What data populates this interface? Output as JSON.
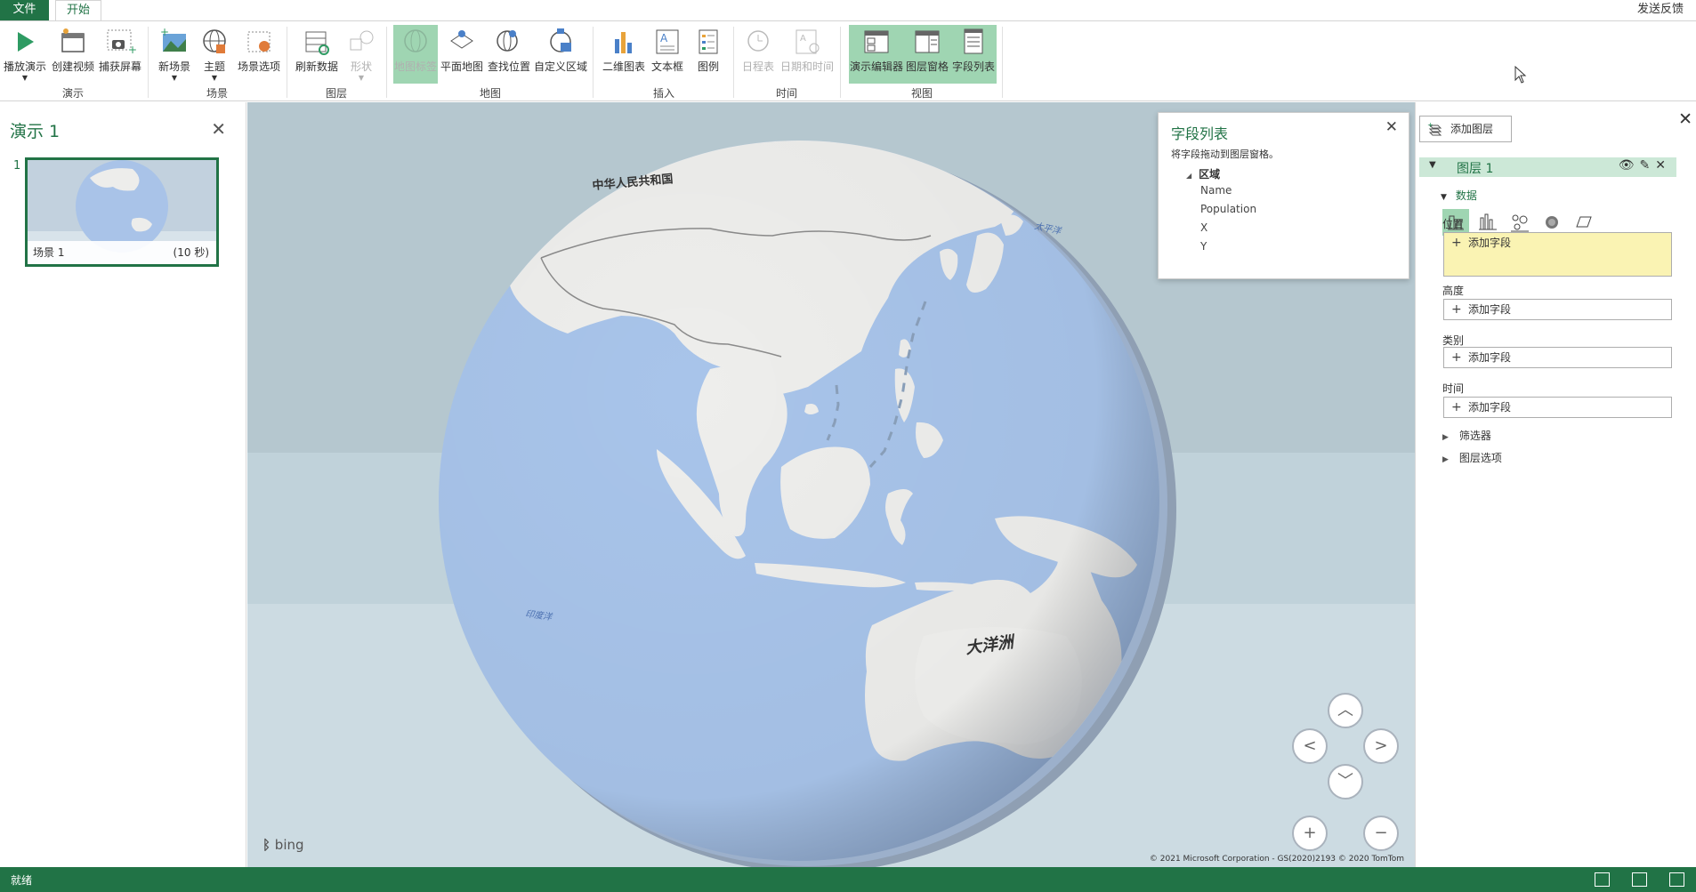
{
  "tabs": {
    "file": "文件",
    "home": "开始",
    "feedback": "发送反馈"
  },
  "ribbon": {
    "groups": [
      {
        "name": "演示",
        "buttons": [
          "播放演示",
          "创建视频",
          "捕获屏幕"
        ]
      },
      {
        "name": "场景",
        "buttons": [
          "新场景",
          "主题",
          "场景选项"
        ]
      },
      {
        "name": "图层",
        "buttons": [
          "刷新数据",
          "形状"
        ]
      },
      {
        "name": "地图",
        "buttons": [
          "地图标签",
          "平面地图",
          "查找位置",
          "自定义区域"
        ]
      },
      {
        "name": "插入",
        "buttons": [
          "二维图表",
          "文本框",
          "图例"
        ]
      },
      {
        "name": "时间",
        "buttons": [
          "日程表",
          "日期和时间"
        ]
      },
      {
        "name": "视图",
        "buttons": [
          "演示编辑器",
          "图层窗格",
          "字段列表"
        ]
      }
    ]
  },
  "tour": {
    "title": "演示 1",
    "scene_number": "1",
    "scene_label": "场景 1",
    "scene_duration": "(10 秒)"
  },
  "map": {
    "labels": {
      "china": "中华人民共和国",
      "oceania": "大洋洲",
      "pacific": "太平洋",
      "indian": "印度洋"
    },
    "bing": "bing",
    "copyright": "© 2021 Microsoft Corporation - GS(2020)2193  © 2020 TomTom",
    "colors": {
      "ocean": "#a8c4ea",
      "land": "#eeeeec",
      "sky_top": "#b3c7cf",
      "sky_bottom": "#d3e0e6"
    }
  },
  "field_list": {
    "title": "字段列表",
    "hint": "将字段拖动到图层窗格。",
    "group": "区域",
    "fields": [
      "Name",
      "Population",
      "X",
      "Y"
    ]
  },
  "layer_pane": {
    "add_layer": "添加图层",
    "layer_name": "图层 1",
    "data_label": "数据",
    "location_label": "位置",
    "height_label": "高度",
    "category_label": "类别",
    "time_label": "时间",
    "add_field": "添加字段",
    "filters": "筛选器",
    "layer_options": "图层选项"
  },
  "status": {
    "text": "就绪"
  },
  "theme": {
    "accent": "#217346",
    "active_button": "#9fd5b2",
    "layer_header": "#cce8d7",
    "location_drop": "#faf3b3"
  }
}
